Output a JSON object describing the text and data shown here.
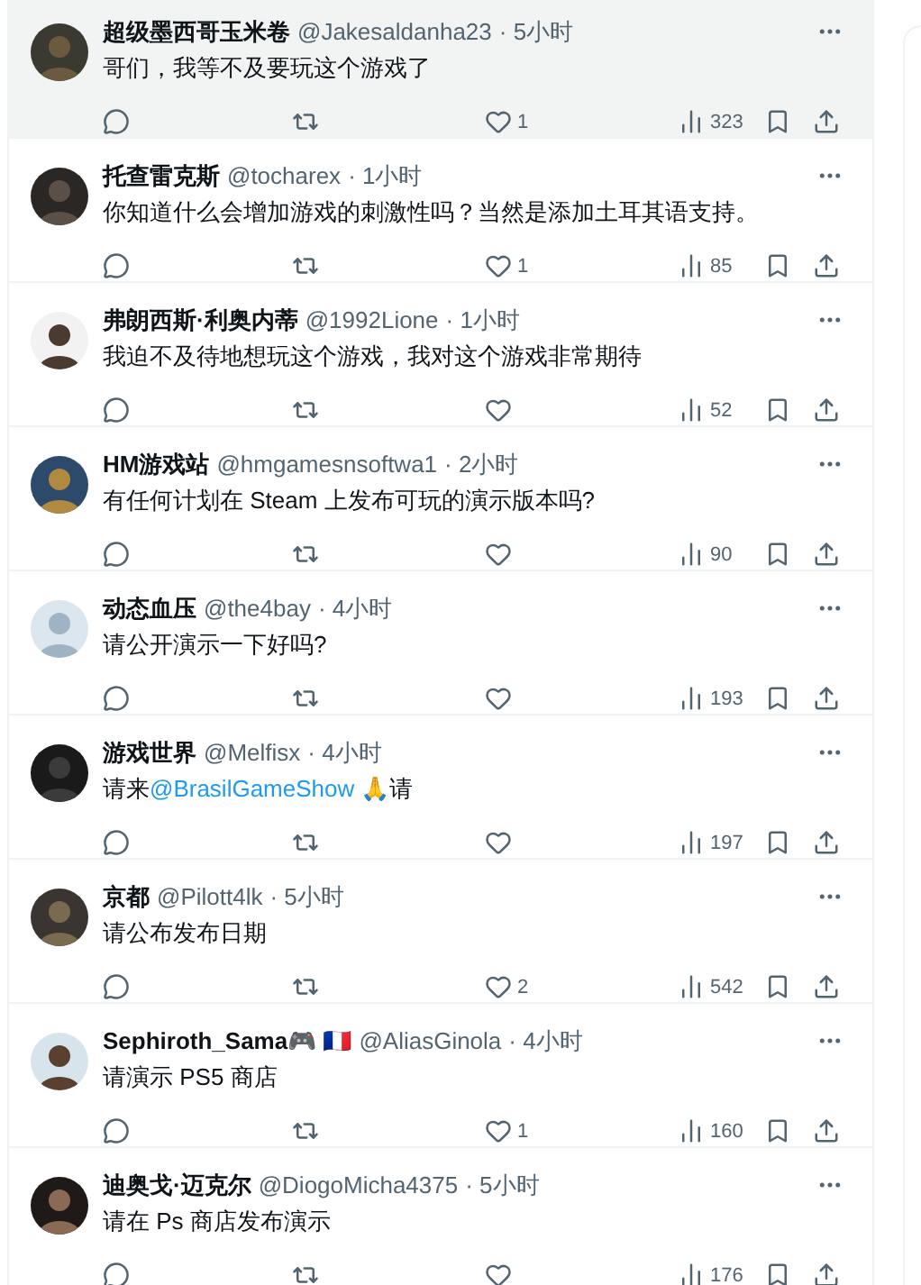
{
  "replies": [
    {
      "name": "超级墨西哥玉米卷",
      "handle": "@Jakesaldanha23",
      "time": "· 5小时",
      "highlighted": true,
      "text": [
        {
          "kind": "text",
          "text": "哥们，我等不及要玩这个游戏了"
        }
      ],
      "likes": "1",
      "views": "323"
    },
    {
      "name": "托查雷克斯",
      "handle": "@tocharex",
      "time": "· 1小时",
      "highlighted": false,
      "text": [
        {
          "kind": "text",
          "text": "你知道什么会增加游戏的刺激性吗？当然是添加土耳其语支持。"
        }
      ],
      "likes": "1",
      "views": "85"
    },
    {
      "name": "弗朗西斯·利奥内蒂",
      "handle": "@1992Lione",
      "time": "· 1小时",
      "highlighted": false,
      "text": [
        {
          "kind": "text",
          "text": "我迫不及待地想玩这个游戏，我对这个游戏非常期待"
        }
      ],
      "views": "52"
    },
    {
      "name": "HM游戏站",
      "handle": "@hmgamesnsoftwa1",
      "time": "· 2小时",
      "highlighted": false,
      "text": [
        {
          "kind": "text",
          "text": "有任何计划在 Steam 上发布可玩的演示版本吗?"
        }
      ],
      "views": "90"
    },
    {
      "name": "动态血压",
      "handle": "@the4bay",
      "time": "· 4小时",
      "highlighted": false,
      "text": [
        {
          "kind": "text",
          "text": "请公开演示一下好吗?"
        }
      ],
      "views": "193"
    },
    {
      "name": "游戏世界",
      "handle": "@Melfisx",
      "time": "· 4小时",
      "highlighted": false,
      "text": [
        {
          "kind": "text",
          "text": "请来"
        },
        {
          "kind": "mention",
          "text": "@BrasilGameShow"
        },
        {
          "kind": "text",
          "text": " 🙏请"
        }
      ],
      "views": "197"
    },
    {
      "name": "京都",
      "handle": "@Pilott4lk",
      "time": "· 5小时",
      "highlighted": false,
      "text": [
        {
          "kind": "text",
          "text": "请公布发布日期"
        }
      ],
      "likes": "2",
      "views": "542"
    },
    {
      "name": "Sephiroth_Sama🎮 🇫🇷",
      "handle": "@AliasGinola",
      "time": "· 4小时",
      "highlighted": false,
      "text": [
        {
          "kind": "text",
          "text": "请演示 PS5 商店"
        }
      ],
      "likes": "1",
      "views": "160"
    },
    {
      "name": "迪奥戈·迈克尔",
      "handle": "@DiogoMicha4375",
      "time": "· 5小时",
      "highlighted": false,
      "text": [
        {
          "kind": "text",
          "text": "请在 Ps 商店发布演示"
        }
      ],
      "views": "176"
    }
  ]
}
